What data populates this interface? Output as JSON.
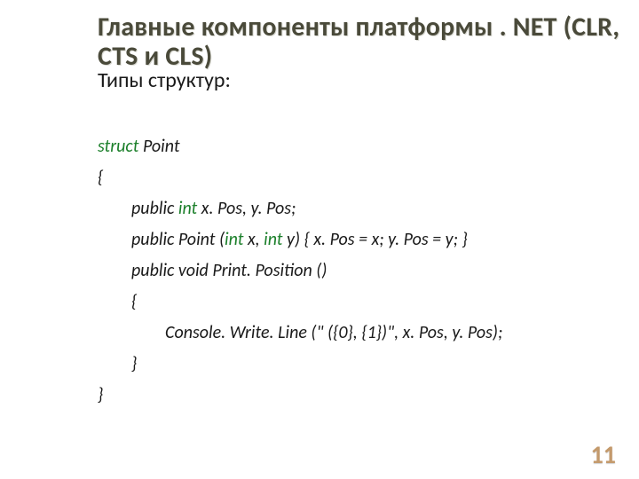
{
  "title": "Главные компоненты платформы . NET (CLR, CTS и CLS)",
  "subtitle": "Типы структур:",
  "kw": {
    "struct": "struct",
    "int": "int"
  },
  "code": {
    "l1": " Point",
    "l2": "{",
    "l3a": "public ",
    "l3b": " x. Pos, y. Pos;",
    "l4a": "public Point (",
    "l4b": " x, ",
    "l4c": " y) { x. Pos = x; y. Pos = y; }",
    "l5": "public void Print. Position ()",
    "l6": "{",
    "l7": "Console. Write. Line (\" ({0}, {1})\", x. Pos, y. Pos);",
    "l8": "}",
    "l9": "}"
  },
  "pagenum": "11"
}
